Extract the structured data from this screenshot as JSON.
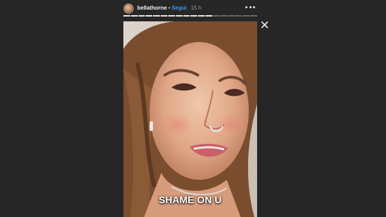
{
  "header": {
    "username": "bellathorne",
    "separator": "•",
    "follow_label": "Segui",
    "time_ago": "15 h"
  },
  "icons": {
    "more": "more-horizontal-icon",
    "close": "close-icon"
  },
  "progress": {
    "segment_count": 18,
    "completed_segments": 12
  },
  "story": {
    "caption": "SHAME ON U"
  },
  "colors": {
    "background": "#262626",
    "follow": "#3897f0",
    "progress_done": "#e8e8e8",
    "progress_todo": "#6b6b6b"
  }
}
